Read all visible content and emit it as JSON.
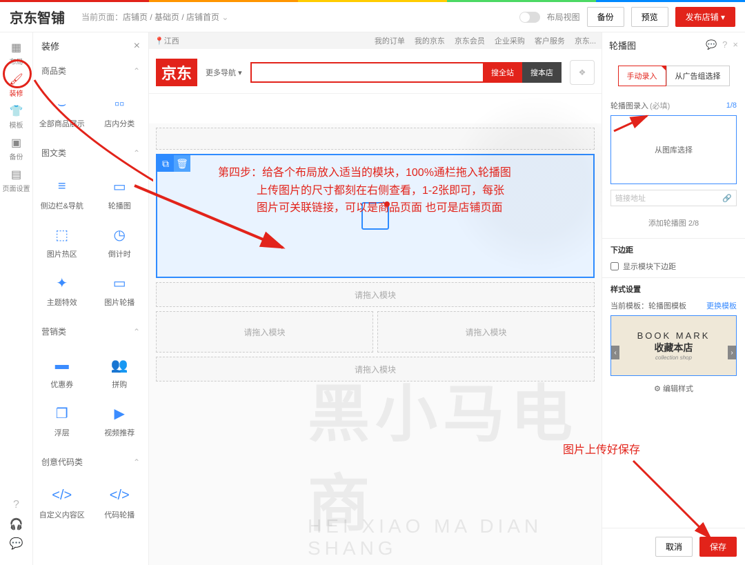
{
  "header": {
    "logo": "京东智铺",
    "crumb_prefix": "当前页面：",
    "crumb": "店铺页 / 基础页 / 店铺首页",
    "layout_view": "布局视图",
    "backup": "备份",
    "preview": "预览",
    "publish": "发布店铺"
  },
  "rail": {
    "items": [
      "布局",
      "装修",
      "模板",
      "备份",
      "页面设置"
    ],
    "active_index": 1
  },
  "panel": {
    "title": "装修",
    "sections": {
      "goods": {
        "title": "商品类",
        "items": [
          "全部商品展示",
          "店内分类"
        ]
      },
      "media": {
        "title": "图文类",
        "items": [
          "侧边栏&导航",
          "轮播图",
          "图片热区",
          "倒计时",
          "主题特效",
          "图片轮播"
        ]
      },
      "marketing": {
        "title": "营销类",
        "items": [
          "优惠券",
          "拼购",
          "浮层",
          "视频推荐"
        ]
      },
      "code": {
        "title": "创意代码类",
        "items": [
          "自定义内容区",
          "代码轮播"
        ]
      }
    }
  },
  "canvas": {
    "loc": "江西",
    "topnav": [
      "...",
      "我的订单",
      "我的京东",
      "京东会员",
      "企业采购",
      "客户服务",
      "...",
      "京东..."
    ],
    "jd_logo": "京东",
    "more_nav": "更多导航",
    "search_all": "搜全站",
    "search_shop": "搜本店",
    "drag_placeholder": "请拖入模块"
  },
  "right": {
    "title": "轮播图",
    "tab_manual": "手动录入",
    "tab_ad": "从广告组选择",
    "carousel_label": "轮播图录入",
    "required": "(必填)",
    "count": "1/8",
    "from_gallery": "从图库选择",
    "link_placeholder": "链接地址",
    "add_more": "添加轮播图 2/8",
    "margin_title": "下边距",
    "margin_chk": "显示模块下边距",
    "style_title": "样式设置",
    "current_tpl_label": "当前模板：",
    "current_tpl": "轮播图模板",
    "change_tpl": "更换模板",
    "thumb": {
      "t1": "BOOK MARK",
      "t2": "收藏本店",
      "t3": "collection shop"
    },
    "edit_style": "编辑样式",
    "cancel": "取消",
    "save": "保存"
  },
  "anno": {
    "step4_l1": "第四步：给各个布局放入适当的模块，100%通栏拖入轮播图",
    "step4_l2": "上传图片的尺寸都刻在右侧查看，1-2张即可，每张",
    "step4_l3": "图片可关联链接，可以是商品页面  也可是店铺页面",
    "save_note": "图片上传好保存"
  },
  "watermark": {
    "big": "黑小马电商",
    "pin": "HEI XIAO MA DIAN SHANG"
  }
}
